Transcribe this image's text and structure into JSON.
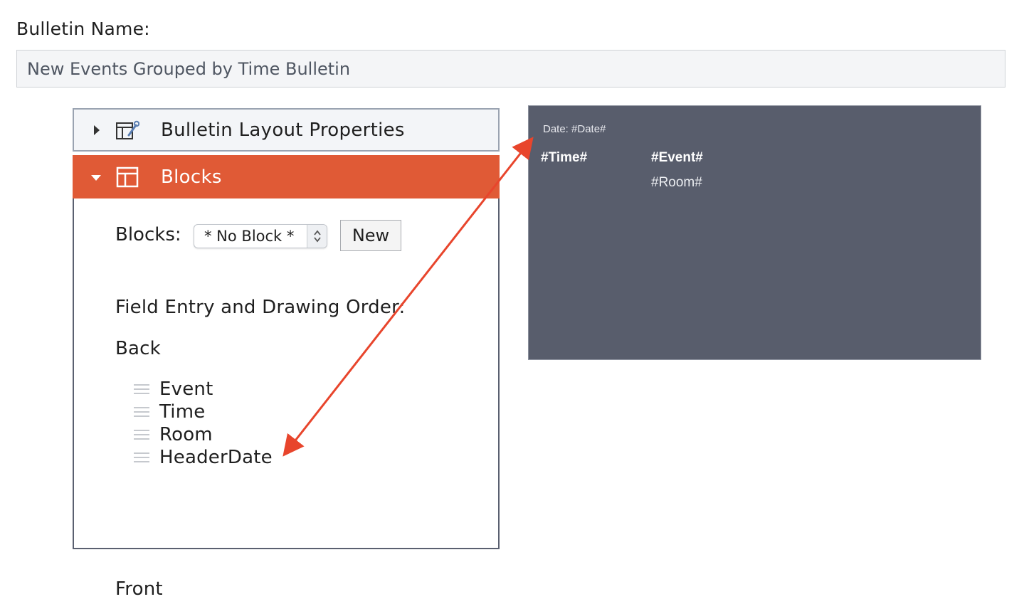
{
  "bulletin": {
    "name_label": "Bulletin Name:",
    "name_value": "New Events Grouped by Time Bulletin"
  },
  "accordion": {
    "layout_properties": {
      "title": "Bulletin Layout Properties",
      "expanded": false,
      "icon": "layout-settings-icon"
    },
    "blocks": {
      "title": "Blocks",
      "expanded": true,
      "icon": "layout-icon",
      "accent_color": "#e05a36",
      "blocks_label": "Blocks:",
      "select_value": "* No Block *",
      "new_button": "New",
      "order_label": "Field Entry and Drawing Order:",
      "back_label": "Back",
      "fields": [
        {
          "name": "Event"
        },
        {
          "name": "Time"
        },
        {
          "name": "Room"
        },
        {
          "name": "HeaderDate"
        }
      ],
      "front_label": "Front"
    }
  },
  "preview": {
    "background_color": "#585d6c",
    "date_text": "Date: #Date#",
    "time_text": "#Time#",
    "event_text": "#Event#",
    "room_text": "#Room#"
  },
  "annotation": {
    "type": "double-headed-arrow",
    "color": "#e8452c",
    "connects": [
      "HeaderDate",
      "Date: #Date#"
    ]
  }
}
